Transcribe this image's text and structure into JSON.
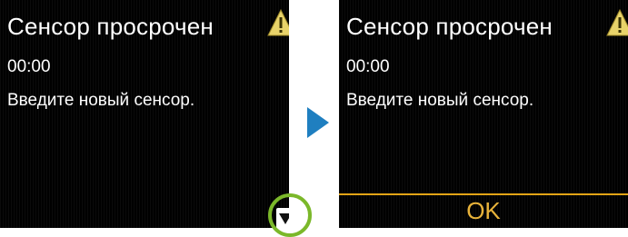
{
  "left_screen": {
    "title": "Сенсор просрочен",
    "time": "00:00",
    "message": "Введите новый сенсор."
  },
  "right_screen": {
    "title": "Сенсор просрочен",
    "time": "00:00",
    "message": "Введите новый сенсор.",
    "ok_label": "OK"
  },
  "icons": {
    "warning": "warning-icon",
    "scroll_down": "chevron-down-icon",
    "transition": "play-arrow-icon"
  },
  "colors": {
    "screen_bg": "#050505",
    "text": "#ffffff",
    "ok_accent": "#e3a416",
    "highlight_ring": "#7bb82a",
    "transition_arrow": "#1f7fc0",
    "warning_yellow": "#e8d36a"
  }
}
